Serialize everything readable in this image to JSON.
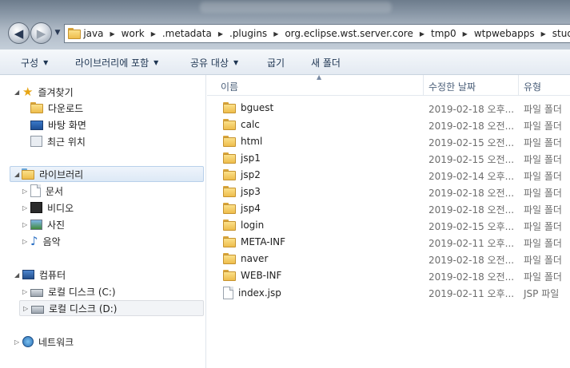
{
  "address": {
    "overflow": "«",
    "crumbs": [
      "java",
      "work",
      ".metadata",
      ".plugins",
      "org.eclipse.wst.server.core",
      "tmp0",
      "wtpwebapps",
      "study"
    ]
  },
  "toolbar": {
    "organize": "구성",
    "include_in_library": "라이브러리에 포함",
    "share_with": "공유 대상",
    "burn": "굽기",
    "new_folder": "새 폴더"
  },
  "nav": {
    "favorites": "즐겨찾기",
    "downloads": "다운로드",
    "desktop": "바탕 화면",
    "recent": "최근 위치",
    "libraries": "라이브러리",
    "documents": "문서",
    "videos": "비디오",
    "pictures": "사진",
    "music": "음악",
    "computer": "컴퓨터",
    "local_c": "로컬 디스크 (C:)",
    "local_d": "로컬 디스크 (D:)",
    "network": "네트워크"
  },
  "columns": {
    "name": "이름",
    "date_modified": "수정한 날짜",
    "type": "유형"
  },
  "files": [
    {
      "name": "bguest",
      "date": "2019-02-18 오후...",
      "type": "파일 폴더",
      "kind": "folder"
    },
    {
      "name": "calc",
      "date": "2019-02-18 오전...",
      "type": "파일 폴더",
      "kind": "folder"
    },
    {
      "name": "html",
      "date": "2019-02-15 오전...",
      "type": "파일 폴더",
      "kind": "folder"
    },
    {
      "name": "jsp1",
      "date": "2019-02-15 오전...",
      "type": "파일 폴더",
      "kind": "folder"
    },
    {
      "name": "jsp2",
      "date": "2019-02-14 오후...",
      "type": "파일 폴더",
      "kind": "folder"
    },
    {
      "name": "jsp3",
      "date": "2019-02-18 오전...",
      "type": "파일 폴더",
      "kind": "folder"
    },
    {
      "name": "jsp4",
      "date": "2019-02-18 오전...",
      "type": "파일 폴더",
      "kind": "folder"
    },
    {
      "name": "login",
      "date": "2019-02-15 오후...",
      "type": "파일 폴더",
      "kind": "folder"
    },
    {
      "name": "META-INF",
      "date": "2019-02-11 오후...",
      "type": "파일 폴더",
      "kind": "folder"
    },
    {
      "name": "naver",
      "date": "2019-02-18 오전...",
      "type": "파일 폴더",
      "kind": "folder"
    },
    {
      "name": "WEB-INF",
      "date": "2019-02-18 오전...",
      "type": "파일 폴더",
      "kind": "folder"
    },
    {
      "name": "index.jsp",
      "date": "2019-02-11 오후...",
      "type": "JSP 파일",
      "kind": "file"
    }
  ]
}
